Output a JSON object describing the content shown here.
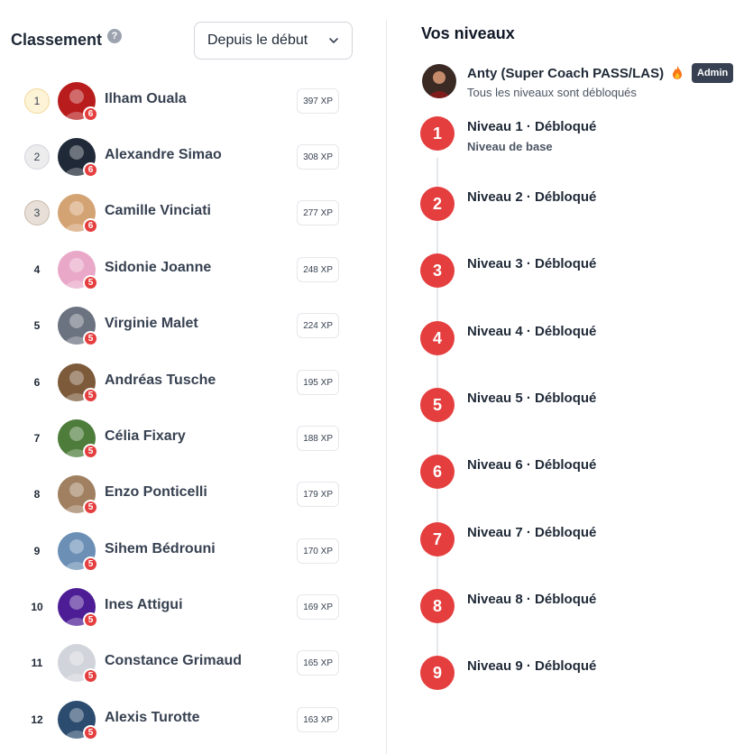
{
  "leaderboard": {
    "title": "Classement",
    "help_icon": "question-icon",
    "period": {
      "selected": "Depuis le début",
      "icon": "chevron-down-icon"
    },
    "members": [
      {
        "rank": "1",
        "name": "Ilham Ouala",
        "level": "6",
        "xp": "397 XP",
        "avatar_color": "#b91c1c"
      },
      {
        "rank": "2",
        "name": "Alexandre Simao",
        "level": "6",
        "xp": "308 XP",
        "avatar_color": "#1f2937"
      },
      {
        "rank": "3",
        "name": "Camille Vinciati",
        "level": "6",
        "xp": "277 XP",
        "avatar_color": "#d4a373"
      },
      {
        "rank": "4",
        "name": "Sidonie Joanne",
        "level": "5",
        "xp": "248 XP",
        "avatar_color": "#e9a8c8"
      },
      {
        "rank": "5",
        "name": "Virginie Malet",
        "level": "5",
        "xp": "224 XP",
        "avatar_color": "#6b7280"
      },
      {
        "rank": "6",
        "name": "Andréas Tusche",
        "level": "5",
        "xp": "195 XP",
        "avatar_color": "#7c5a3a"
      },
      {
        "rank": "7",
        "name": "Célia Fixary",
        "level": "5",
        "xp": "188 XP",
        "avatar_color": "#4d7c3b"
      },
      {
        "rank": "8",
        "name": "Enzo Ponticelli",
        "level": "5",
        "xp": "179 XP",
        "avatar_color": "#a08060"
      },
      {
        "rank": "9",
        "name": "Sihem Bédrouni",
        "level": "5",
        "xp": "170 XP",
        "avatar_color": "#6b8fb5"
      },
      {
        "rank": "10",
        "name": "Ines Attigui",
        "level": "5",
        "xp": "169 XP",
        "avatar_color": "#4c1d95"
      },
      {
        "rank": "11",
        "name": "Constance Grimaud",
        "level": "5",
        "xp": "165 XP",
        "avatar_color": "#d1d5db"
      },
      {
        "rank": "12",
        "name": "Alexis Turotte",
        "level": "5",
        "xp": "163 XP",
        "avatar_color": "#2b4c6f"
      }
    ],
    "top_rank_colors": [
      "#fdf3d7",
      "#ececec",
      "#e8e0d8"
    ]
  },
  "levels_panel": {
    "title": "Vos niveaux",
    "user": {
      "name": "Anty (Super Coach PASS/LAS)",
      "icon": "fire-icon",
      "badge": "Admin",
      "subtitle": "Tous les niveaux sont débloqués"
    },
    "accent_color": "#e53e3e",
    "levels": [
      {
        "number": "1",
        "label": "Niveau 1 · Débloqué",
        "description": "Niveau de base"
      },
      {
        "number": "2",
        "label": "Niveau 2 · Débloqué"
      },
      {
        "number": "3",
        "label": "Niveau 3 · Débloqué"
      },
      {
        "number": "4",
        "label": "Niveau 4 · Débloqué"
      },
      {
        "number": "5",
        "label": "Niveau 5 · Débloqué"
      },
      {
        "number": "6",
        "label": "Niveau 6 · Débloqué"
      },
      {
        "number": "7",
        "label": "Niveau 7 · Débloqué"
      },
      {
        "number": "8",
        "label": "Niveau 8 · Débloqué"
      },
      {
        "number": "9",
        "label": "Niveau 9 · Débloqué"
      }
    ]
  }
}
